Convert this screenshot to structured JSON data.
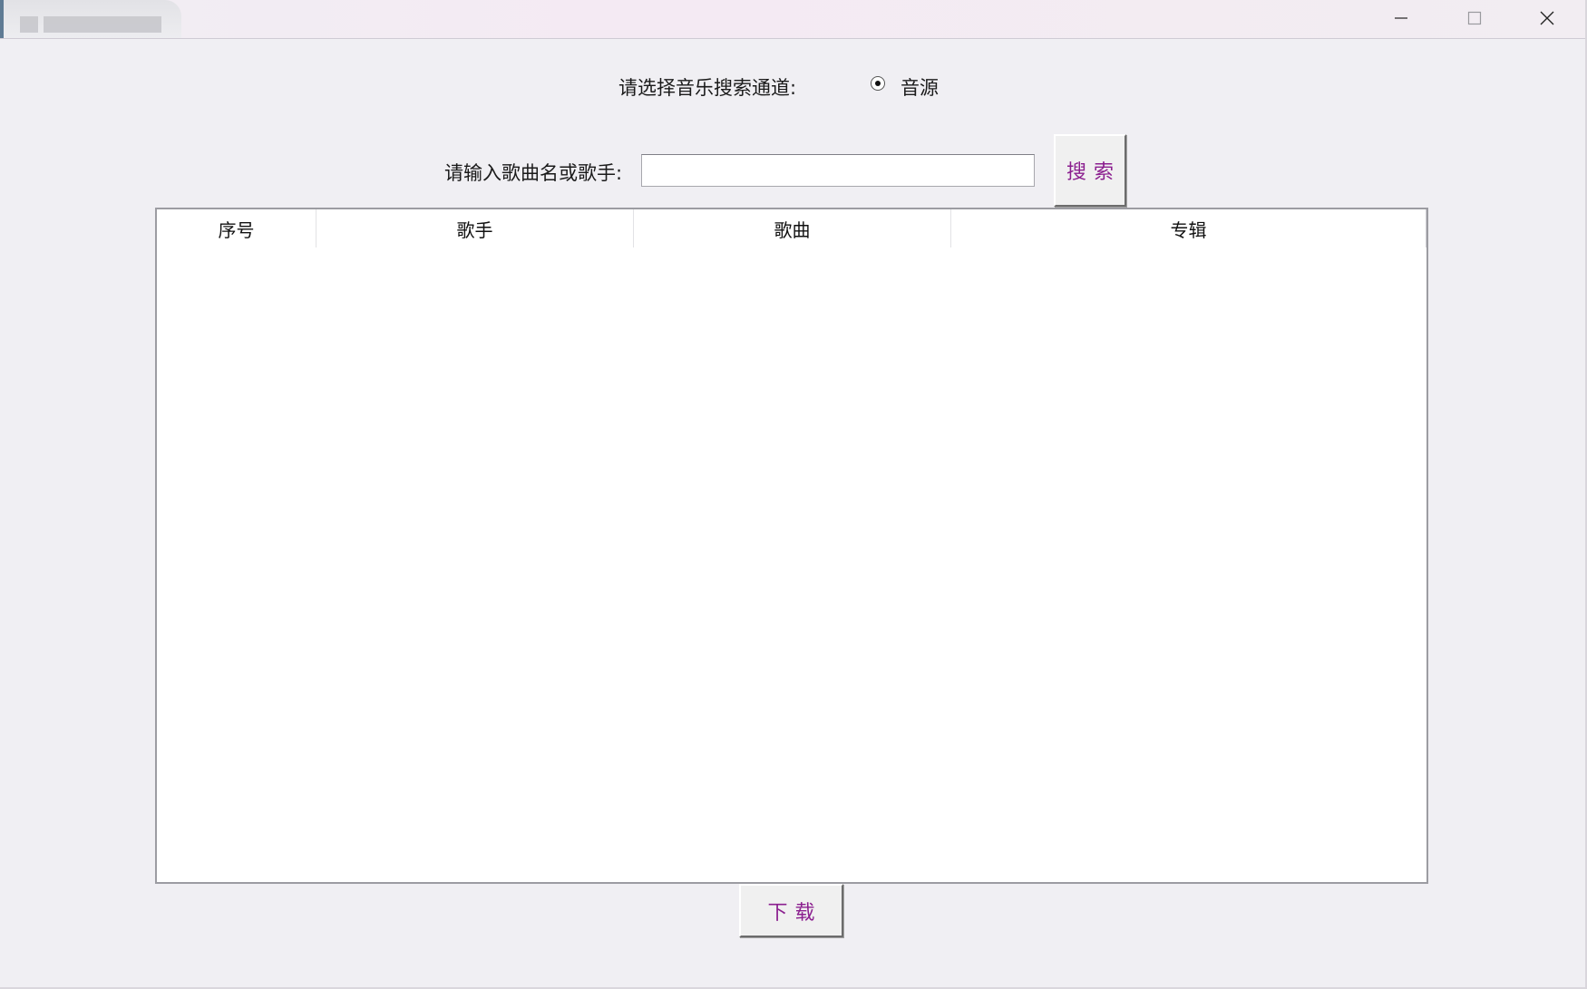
{
  "window": {
    "title": ""
  },
  "channel": {
    "label": "请选择音乐搜索通道:",
    "options": [
      {
        "label": "音源",
        "selected": true
      }
    ]
  },
  "search": {
    "label": "请输入歌曲名或歌手:",
    "value": "",
    "placeholder": "",
    "button_label": "搜索"
  },
  "results_table": {
    "columns": [
      "序号",
      "歌手",
      "歌曲",
      "专辑"
    ],
    "rows": []
  },
  "download": {
    "button_label": "下载"
  },
  "colors": {
    "button_text": "#8b1f8f",
    "window_bg": "#f0eff3"
  },
  "icons": {
    "minimize": "minimize-icon",
    "maximize": "maximize-icon",
    "close": "close-icon"
  }
}
